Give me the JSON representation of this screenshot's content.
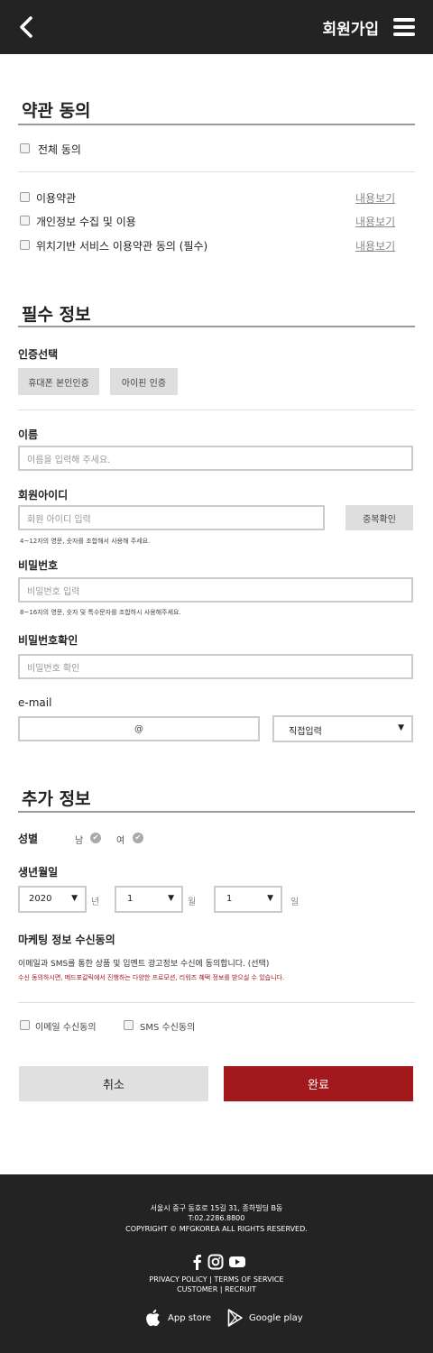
{
  "header": {
    "title": "회원가입",
    "back_icon": "chevron-left-icon",
    "menu_icon": "hamburger-menu-icon"
  },
  "terms": {
    "title": "약관 동의",
    "agree_all": "전체 동의",
    "items": [
      {
        "label": "이용약관",
        "view": "내용보기"
      },
      {
        "label": "개인정보 수집 및 이용",
        "view": "내용보기"
      },
      {
        "label": "위치기반 서비스 이용약관 동의 (필수)",
        "view": "내용보기"
      }
    ]
  },
  "required": {
    "title": "필수 정보",
    "auth_label": "인증선택",
    "auth_phone": "휴대폰 본인인증",
    "auth_ipin": "아이핀 인증",
    "name_label": "이름",
    "name_placeholder": "이름을 입력해 주세요.",
    "id_label": "회원아이디",
    "id_placeholder": "회원 아이디 입력",
    "id_check": "중복확인",
    "id_help": "4~12자의 영문, 숫자를 조합해서 사용해 주세요.",
    "pw_label": "비밀번호",
    "pw_placeholder": "비밀번호 입력",
    "pw_help": "8~16자의 영문, 숫자 및 특수문자를 조합하시 사용해주세요.",
    "pw2_label": "비밀번호확인",
    "pw2_placeholder": "비밀번호 확인",
    "email_label": "e-mail",
    "email_at": "@",
    "email_domain": "직접입력"
  },
  "extra": {
    "title": "추가 정보",
    "gender_label": "성별",
    "male": "남",
    "female": "여",
    "birth_label": "생년월일",
    "year": "2020",
    "year_unit": "년",
    "month": "1",
    "month_unit": "월",
    "day": "1",
    "day_unit": "일",
    "marketing_label": "마케팅 정보 수신동의",
    "marketing_desc": "이메일과 SMS를 통한 상품 및 입멘트 광고정보 수신에 동의합니다. (선택)",
    "marketing_note": "수신 동의하시면, 메드포갈릭에서 진행하는 다양한 프로모션, 리워즈 혜택 정보를 받으실 수 있습니다.",
    "email_consent": "이메일 수신동의",
    "sms_consent": "SMS 수신동의"
  },
  "actions": {
    "cancel": "취소",
    "done": "완료"
  },
  "footer": {
    "address": "서울시 중구 동호로 15길 31, 종하빌딩 B동",
    "tel": "T:02.2286.8800",
    "copyright": "COPYRIGHT © MFGKOREA ALL RIGHTS RESERVED.",
    "links1": "PRIVACY POLICY | TERMS OF SERVICE",
    "links2": "CUSTOMER | RECRUIT",
    "app_store": "App store",
    "google_play": "Google play"
  },
  "colors": {
    "header_bg": "#232323",
    "accent": "#a3181c",
    "button_gray": "#e0e0e0"
  }
}
